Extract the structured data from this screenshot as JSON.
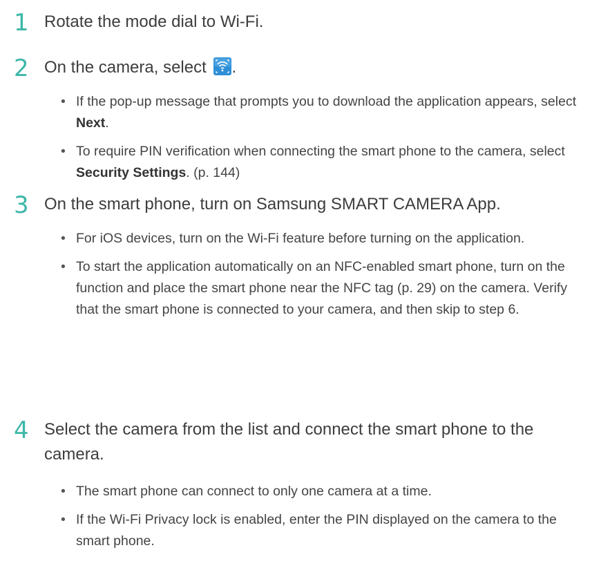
{
  "steps": [
    {
      "number": "1",
      "text": "Rotate the mode dial to Wi-Fi.",
      "bullets": []
    },
    {
      "number": "2",
      "text_before_icon": "On the camera, select",
      "text_after_icon": ".",
      "icon": "wifi-mode-icon",
      "bullets": [
        {
          "parts": [
            "If the pop-up message that prompts you to download the application appears, select ",
            "Next",
            "."
          ]
        },
        {
          "parts": [
            "To require PIN verification when connecting the smart phone to the camera, select ",
            "Security Settings",
            ". (p. 144)"
          ]
        }
      ]
    },
    {
      "number": "3",
      "text": "On the smart phone, turn on Samsung SMART CAMERA App.",
      "bullets": [
        {
          "text": "For iOS devices, turn on the Wi-Fi feature before turning on the application."
        },
        {
          "text": "To start the application automatically on an NFC-enabled smart phone, turn on the function and place the smart phone near the NFC tag (p. 29) on the camera. Verify that the smart phone is connected to your camera, and then skip to step 6."
        }
      ]
    },
    {
      "number": "4",
      "text": "Select the camera from the list and connect the smart phone to the camera.",
      "bullets": [
        {
          "text": "The smart phone can connect to only one camera at a time."
        },
        {
          "text": "If the Wi-Fi Privacy lock is enabled, enter the PIN displayed on the camera to the smart phone."
        }
      ]
    }
  ],
  "colors": {
    "accent": "#3cb7a8",
    "icon_bg": "#2f8fd6",
    "text": "#3d3d3d"
  }
}
